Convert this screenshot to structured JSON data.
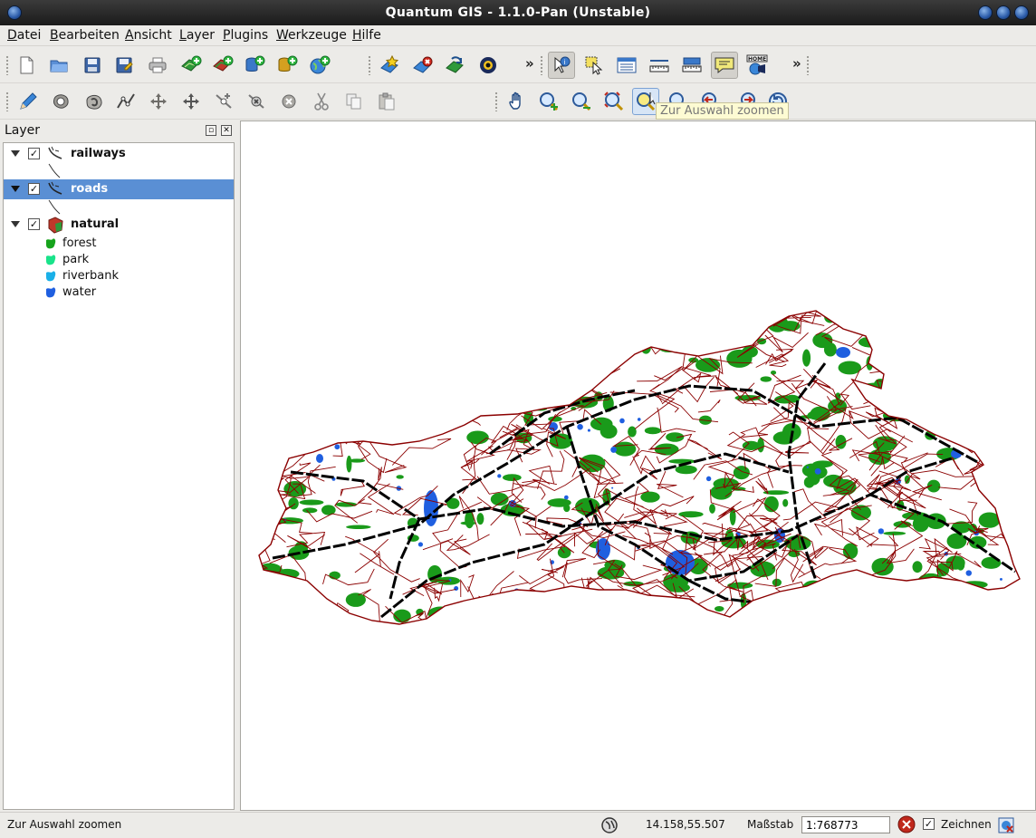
{
  "window": {
    "title": "Quantum GIS - 1.1.0-Pan (Unstable)"
  },
  "menu": [
    "Datei",
    "Bearbeiten",
    "Ansicht",
    "Layer",
    "Plugins",
    "Werkzeuge",
    "Hilfe"
  ],
  "toolbar": {
    "overflow_glyph": "»"
  },
  "tooltip": {
    "text": "Zur Auswahl zoomen"
  },
  "layer_panel": {
    "title": "Layer",
    "layers": [
      {
        "name": "railways",
        "visible": true,
        "selected": false
      },
      {
        "name": "roads",
        "visible": true,
        "selected": true
      },
      {
        "name": "natural",
        "visible": true,
        "selected": false,
        "classes": [
          {
            "label": "forest",
            "color": "#16a31c"
          },
          {
            "label": "park",
            "color": "#19e38a"
          },
          {
            "label": "riverbank",
            "color": "#1ab0e8"
          },
          {
            "label": "water",
            "color": "#1f5fe0"
          }
        ]
      }
    ]
  },
  "map_colors": {
    "roads": "#8b0000",
    "railways": "#000000",
    "forest": "#1a9a1a",
    "water": "#1f5fe0",
    "background": "#ffffff"
  },
  "statusbar": {
    "message": "Zur Auswahl zoomen",
    "coordinates": "14.158,55.507",
    "scale_label": "Maßstab",
    "scale_value": "1:768773",
    "render_label": "Zeichnen",
    "render_checked": true
  }
}
